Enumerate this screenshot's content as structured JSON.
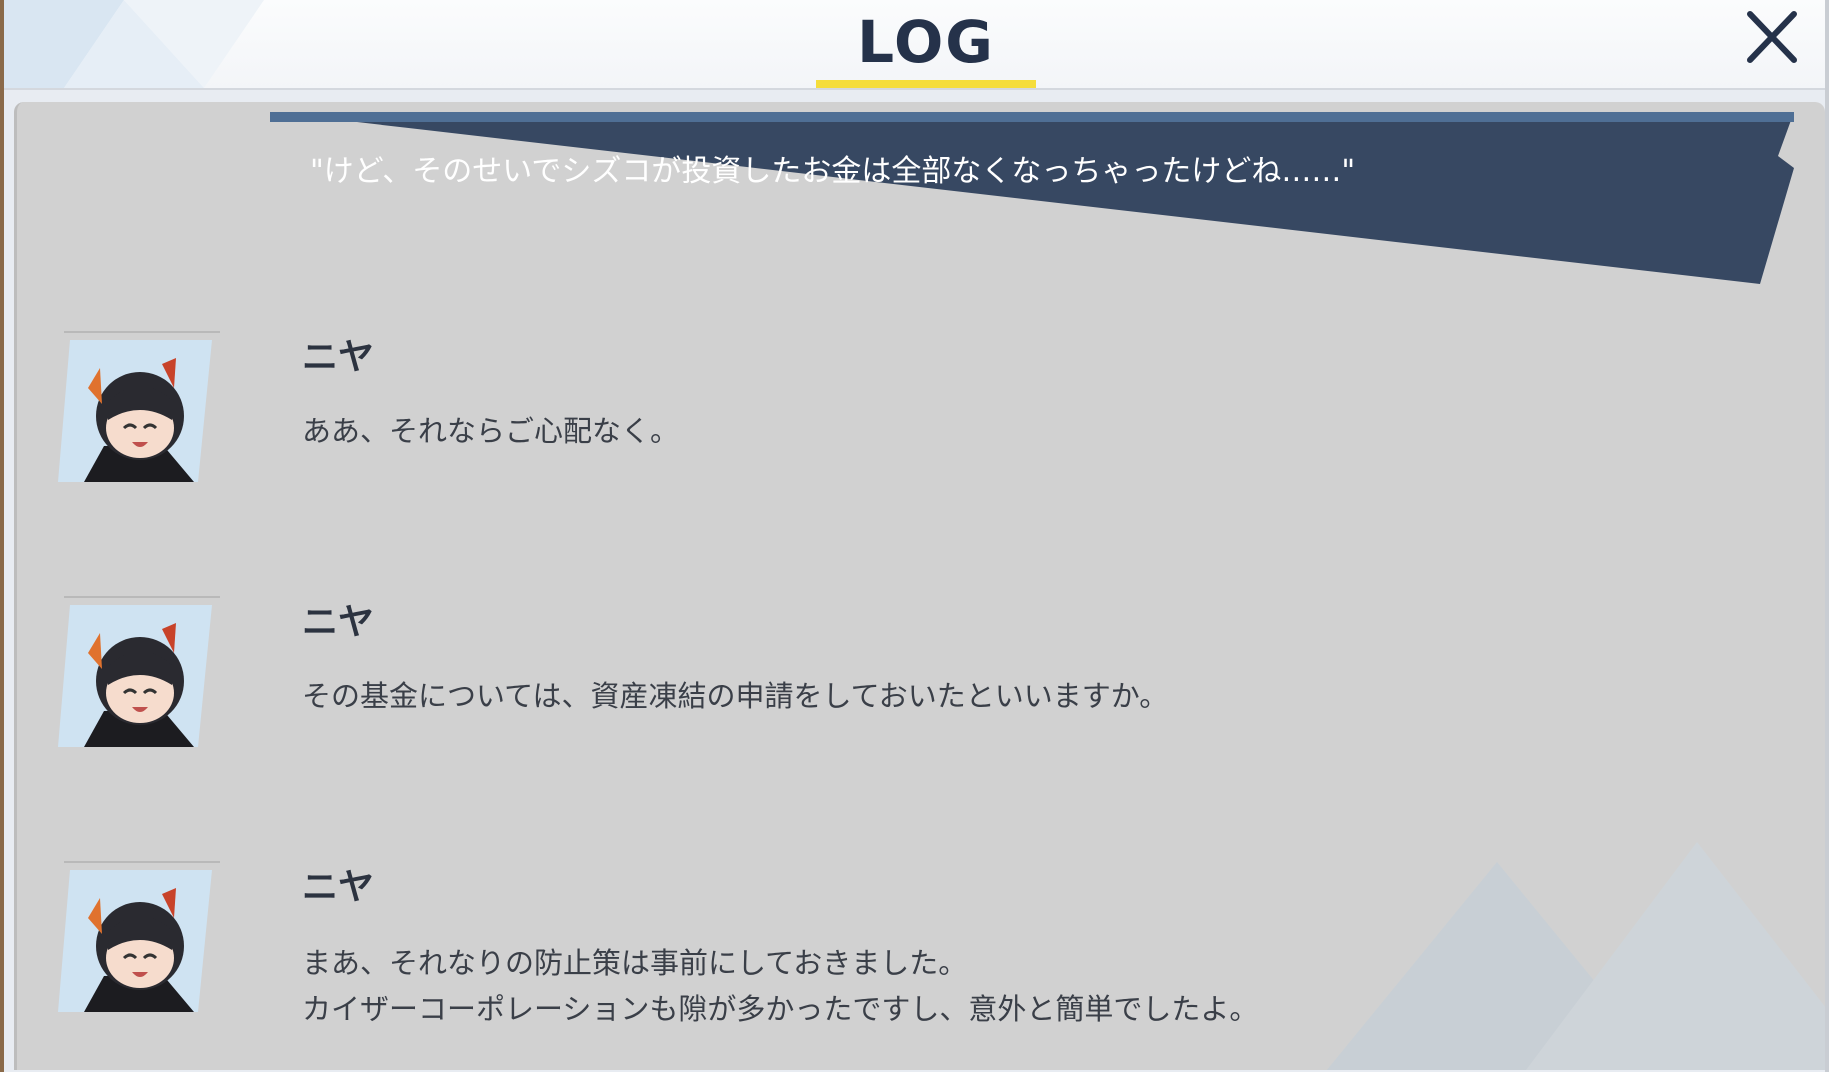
{
  "header": {
    "title": "LOG",
    "close_icon": "close-icon"
  },
  "colors": {
    "accent": "#f5dd3b",
    "narration_bg": "#374862",
    "title": "#25324a"
  },
  "narration": {
    "text": "\"けど、そのせいでシズコが投資したお金は全部なくなっちゃったけどね……\""
  },
  "entries": [
    {
      "speaker": "ニヤ",
      "lines": [
        "ああ、それならご心配なく。"
      ]
    },
    {
      "speaker": "ニヤ",
      "lines": [
        "その基金については、資産凍結の申請をしておいたといいますか。"
      ]
    },
    {
      "speaker": "ニヤ",
      "lines": [
        "まあ、それなりの防止策は事前にしておきました。",
        "カイザーコーポレーションも隙が多かったですし、意外と簡単でしたよ。"
      ]
    }
  ]
}
